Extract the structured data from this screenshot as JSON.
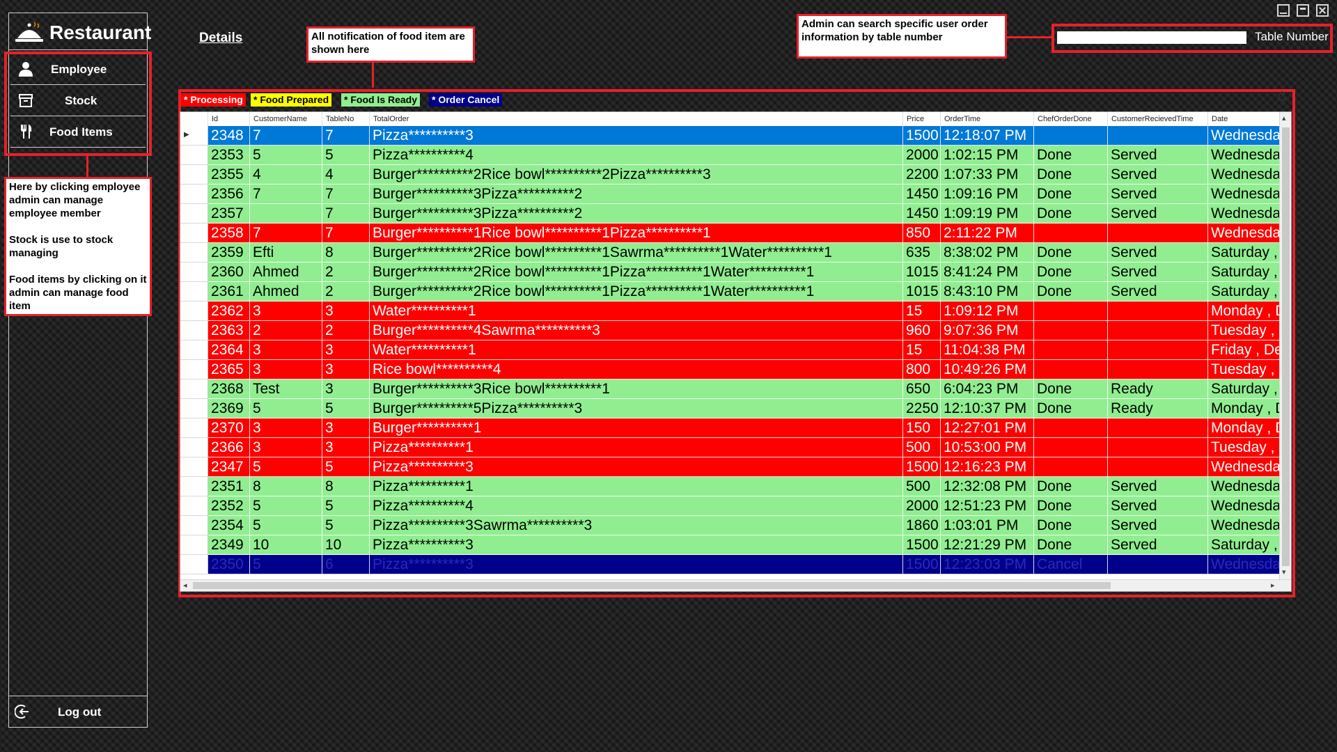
{
  "app": {
    "title": "Restaurant"
  },
  "sidebar": {
    "items": [
      {
        "label": "Employee",
        "icon": "person-icon"
      },
      {
        "label": "Stock",
        "icon": "archive-icon"
      },
      {
        "label": "Food Items",
        "icon": "fork-knife-icon"
      }
    ],
    "logout_label": "Log out"
  },
  "header": {
    "details_link": "Details"
  },
  "search": {
    "label": "Table Number",
    "value": ""
  },
  "annotations": {
    "notifications": "All notification of food item are shown here",
    "search": "Admin can search specific user order information by table number",
    "sidebar": "Here by clicking employee admin can manage employee member\n\nStock is use to stock managing\n\nFood items by clicking on it admin can manage food item"
  },
  "legend": [
    {
      "label": "* Processing",
      "bg": "#ff0000",
      "fg": "#ffffff"
    },
    {
      "label": "* Food Prepared",
      "bg": "#ffff00",
      "fg": "#000000"
    },
    {
      "label": "* Food Is Ready",
      "bg": "#90ee90",
      "fg": "#000000"
    },
    {
      "label": "* Order Cancel",
      "bg": "#00008b",
      "fg": "#ffffff"
    }
  ],
  "status_colors": {
    "processing": "#ff0000",
    "ready": "#90ee90",
    "cancel": "#00008b",
    "selected": "#0078d7"
  },
  "table": {
    "columns": [
      "Id",
      "CustomerName",
      "TableNo",
      "TotalOrder",
      "Price",
      "OrderTime",
      "ChefOrderDone",
      "CustomerRecievedTime",
      "Date"
    ],
    "rows": [
      {
        "status": "selected",
        "cells": [
          "2348",
          "7",
          "7",
          "Pizza**********3",
          "1500",
          "12:18:07 PM",
          "",
          "",
          "Wednesday"
        ]
      },
      {
        "status": "ready",
        "cells": [
          "2353",
          "5",
          "5",
          "Pizza**********4",
          "2000",
          "1:02:15 PM",
          "Done",
          "Served",
          "Wednesday"
        ]
      },
      {
        "status": "ready",
        "cells": [
          "2355",
          "4",
          "4",
          "Burger**********2Rice bowl**********2Pizza**********3",
          "2200",
          "1:07:33 PM",
          "Done",
          "Served",
          "Wednesday"
        ]
      },
      {
        "status": "ready",
        "cells": [
          "2356",
          "7",
          "7",
          "Burger**********3Pizza**********2",
          "1450",
          "1:09:16 PM",
          "Done",
          "Served",
          "Wednesday"
        ]
      },
      {
        "status": "ready",
        "cells": [
          "2357",
          "",
          "7",
          "Burger**********3Pizza**********2",
          "1450",
          "1:09:19 PM",
          "Done",
          "Served",
          "Wednesday"
        ]
      },
      {
        "status": "processing",
        "cells": [
          "2358",
          "7",
          "7",
          "Burger**********1Rice bowl**********1Pizza**********1",
          "850",
          "2:11:22 PM",
          "",
          "",
          "Wednesday"
        ]
      },
      {
        "status": "ready",
        "cells": [
          "2359",
          "Efti",
          "8",
          "Burger**********2Rice bowl**********1Sawrma**********1Water**********1",
          "635",
          "8:38:02 PM",
          "Done",
          "Served",
          "Saturday , D"
        ]
      },
      {
        "status": "ready",
        "cells": [
          "2360",
          "Ahmed",
          "2",
          "Burger**********2Rice bowl**********1Pizza**********1Water**********1",
          "1015",
          "8:41:24 PM",
          "Done",
          "Served",
          "Saturday , D"
        ]
      },
      {
        "status": "ready",
        "cells": [
          "2361",
          "Ahmed",
          "2",
          "Burger**********2Rice bowl**********1Pizza**********1Water**********1",
          "1015",
          "8:43:10 PM",
          "Done",
          "Served",
          "Saturday , D"
        ]
      },
      {
        "status": "processing",
        "cells": [
          "2362",
          "3",
          "3",
          "Water**********1",
          "15",
          "1:09:12 PM",
          "",
          "",
          "Monday , De"
        ]
      },
      {
        "status": "processing",
        "cells": [
          "2363",
          "2",
          "2",
          "Burger**********4Sawrma**********3",
          "960",
          "9:07:36 PM",
          "",
          "",
          "Tuesday , D"
        ]
      },
      {
        "status": "processing",
        "cells": [
          "2364",
          "3",
          "3",
          "Water**********1",
          "15",
          "11:04:38 PM",
          "",
          "",
          "Friday , Dec"
        ]
      },
      {
        "status": "processing",
        "cells": [
          "2365",
          "3",
          "3",
          "Rice bowl**********4",
          "800",
          "10:49:26 PM",
          "",
          "",
          "Tuesday , D"
        ]
      },
      {
        "status": "ready",
        "cells": [
          "2368",
          "Test",
          "3",
          "Burger**********3Rice bowl**********1",
          "650",
          "6:04:23 PM",
          "Done",
          "Ready",
          "Saturday , D"
        ]
      },
      {
        "status": "ready",
        "cells": [
          "2369",
          "5",
          "5",
          "Burger**********5Pizza**********3",
          "2250",
          "12:10:37 PM",
          "Done",
          "Ready",
          "Monday , De"
        ]
      },
      {
        "status": "processing",
        "cells": [
          "2370",
          "3",
          "3",
          "Burger**********1",
          "150",
          "12:27:01 PM",
          "",
          "",
          "Monday , De"
        ]
      },
      {
        "status": "processing",
        "cells": [
          "2366",
          "3",
          "3",
          "Pizza**********1",
          "500",
          "10:53:00 PM",
          "",
          "",
          "Tuesday , D"
        ]
      },
      {
        "status": "processing",
        "cells": [
          "2347",
          "5",
          "5",
          "Pizza**********3",
          "1500",
          "12:16:23 PM",
          "",
          "",
          "Wednesday"
        ]
      },
      {
        "status": "ready",
        "cells": [
          "2351",
          "8",
          "8",
          "Pizza**********1",
          "500",
          "12:32:08 PM",
          "Done",
          "Served",
          "Wednesday"
        ]
      },
      {
        "status": "ready",
        "cells": [
          "2352",
          "5",
          "5",
          "Pizza**********4",
          "2000",
          "12:51:23 PM",
          "Done",
          "Served",
          "Wednesday"
        ]
      },
      {
        "status": "ready",
        "cells": [
          "2354",
          "5",
          "5",
          "Pizza**********3Sawrma**********3",
          "1860",
          "1:03:01 PM",
          "Done",
          "Served",
          "Wednesday"
        ]
      },
      {
        "status": "ready",
        "cells": [
          "2349",
          "10",
          "10",
          "Pizza**********3",
          "1500",
          "12:21:29 PM",
          "Done",
          "Served",
          "Saturday , D"
        ]
      },
      {
        "status": "cancel",
        "cells": [
          "2350",
          "5",
          "6",
          "Pizza**********3",
          "1500",
          "12:23:03 PM",
          "Cancel",
          "",
          "Wednesday"
        ]
      }
    ]
  }
}
